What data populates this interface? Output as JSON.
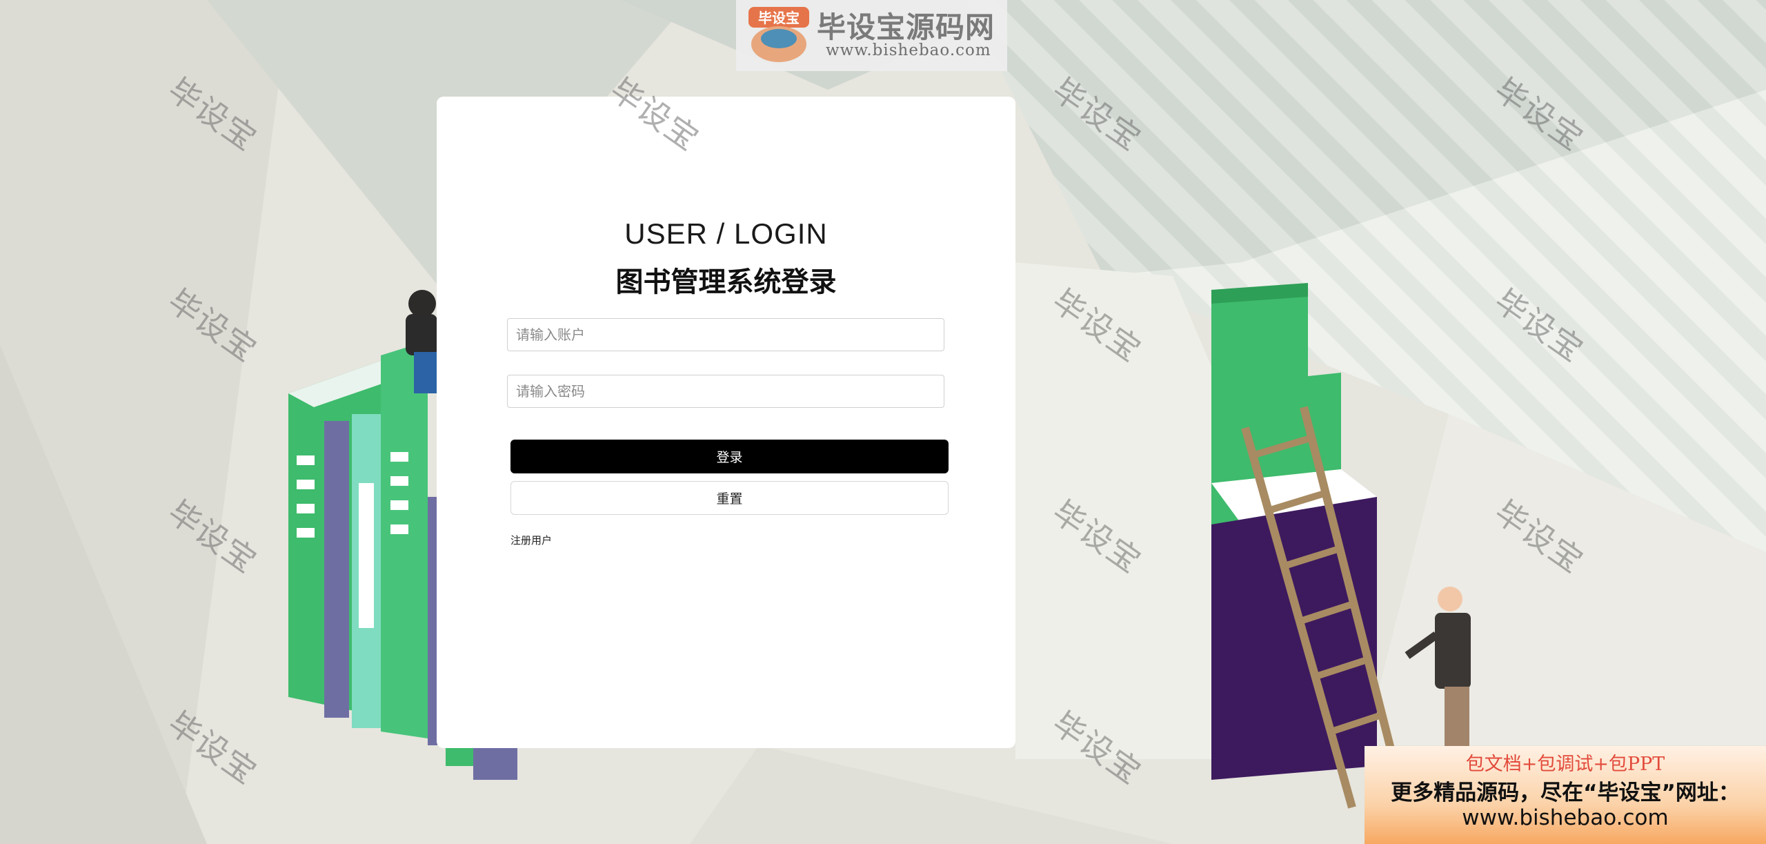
{
  "logo": {
    "badge_text": "毕设宝",
    "title": "毕设宝源码网",
    "url": "www.bishebao.com"
  },
  "login": {
    "subtitle": "USER / LOGIN",
    "title": "图书管理系统登录",
    "account_placeholder": "请输入账户",
    "password_placeholder": "请输入密码",
    "login_button": "登录",
    "reset_button": "重置",
    "register_link": "注册用户"
  },
  "watermark": {
    "text": "毕设宝"
  },
  "promo": {
    "line1": "包文档+包调试+包PPT",
    "line2": "更多精品源码，尽在“毕设宝”网址：",
    "line3": "www.bishebao.com"
  },
  "colors": {
    "book_green": "#3ebb6c",
    "book_purple": "#3d1a5e",
    "login_button_bg": "#000000",
    "promo_red": "#e24a3b"
  }
}
